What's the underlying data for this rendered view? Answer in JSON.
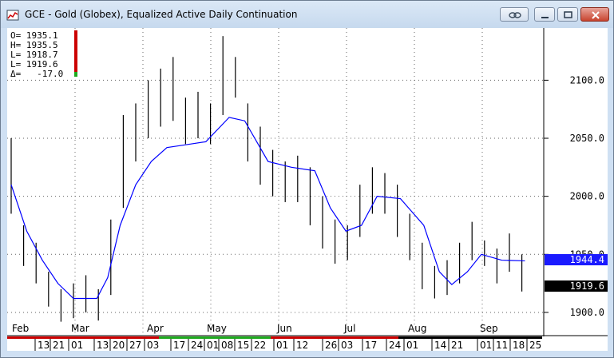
{
  "window": {
    "title": "GCE - Gold (Globex), Equalized Active Daily Continuation",
    "buttons": {
      "link": "link-icon",
      "minimize": "minimize-icon",
      "restore": "restore-icon",
      "close": "close-icon"
    }
  },
  "info": {
    "open": "O= 1935.1",
    "high": "H= 1935.5",
    "low": "L= 1918.7",
    "last": "L= 1919.6",
    "change": "Δ=   -17.0"
  },
  "price_axis": {
    "ticks": [
      "2100.0",
      "2050.0",
      "2000.0",
      "1950.0",
      "1900.0"
    ],
    "ma_label": "1944.4",
    "last_label": "1919.6"
  },
  "time_axis": {
    "months": [
      "Feb",
      "Mar",
      "Apr",
      "May",
      "Jun",
      "Jul",
      "Aug",
      "Sep"
    ],
    "days": [
      "13",
      "21",
      "01",
      "13",
      "20",
      "27",
      "03",
      "17",
      "24",
      "01",
      "08",
      "15",
      "22",
      "01",
      "12",
      "26",
      "03",
      "17",
      "24",
      "01",
      "14",
      "21",
      "01",
      "11",
      "18",
      "25"
    ]
  },
  "colors": {
    "ma_line": "#0000ff",
    "ma_label_bg": "#1a1aff",
    "last_label_bg": "#000000",
    "up_change": "#1faa1f",
    "down_change": "#cc0000"
  },
  "chart_data": {
    "type": "bar",
    "ylim": [
      1880,
      2145
    ],
    "moving_average": [
      {
        "x": 0,
        "y": 2010
      },
      {
        "x": 10,
        "y": 1970
      },
      {
        "x": 20,
        "y": 1945
      },
      {
        "x": 30,
        "y": 1925
      },
      {
        "x": 40,
        "y": 1912
      },
      {
        "x": 55,
        "y": 1912
      },
      {
        "x": 62,
        "y": 1930
      },
      {
        "x": 70,
        "y": 1975
      },
      {
        "x": 80,
        "y": 2010
      },
      {
        "x": 90,
        "y": 2030
      },
      {
        "x": 100,
        "y": 2042
      },
      {
        "x": 115,
        "y": 2045
      },
      {
        "x": 125,
        "y": 2047
      },
      {
        "x": 140,
        "y": 2068
      },
      {
        "x": 150,
        "y": 2065
      },
      {
        "x": 165,
        "y": 2030
      },
      {
        "x": 180,
        "y": 2025
      },
      {
        "x": 195,
        "y": 2022
      },
      {
        "x": 205,
        "y": 1990
      },
      {
        "x": 215,
        "y": 1970
      },
      {
        "x": 225,
        "y": 1975
      },
      {
        "x": 235,
        "y": 2000
      },
      {
        "x": 250,
        "y": 1998
      },
      {
        "x": 265,
        "y": 1975
      },
      {
        "x": 275,
        "y": 1935
      },
      {
        "x": 283,
        "y": 1924
      },
      {
        "x": 293,
        "y": 1935
      },
      {
        "x": 302,
        "y": 1950
      },
      {
        "x": 315,
        "y": 1945
      },
      {
        "x": 330,
        "y": 1944.4
      }
    ],
    "bars": [
      {
        "x": 0,
        "h": 2050,
        "l": 1985
      },
      {
        "x": 8,
        "h": 1975,
        "l": 1940
      },
      {
        "x": 16,
        "h": 1960,
        "l": 1925
      },
      {
        "x": 24,
        "h": 1935,
        "l": 1905
      },
      {
        "x": 32,
        "h": 1920,
        "l": 1892
      },
      {
        "x": 40,
        "h": 1925,
        "l": 1895
      },
      {
        "x": 48,
        "h": 1932,
        "l": 1900
      },
      {
        "x": 56,
        "h": 1920,
        "l": 1893
      },
      {
        "x": 64,
        "h": 1980,
        "l": 1915
      },
      {
        "x": 72,
        "h": 2070,
        "l": 1990
      },
      {
        "x": 80,
        "h": 2080,
        "l": 2030
      },
      {
        "x": 88,
        "h": 2100,
        "l": 2050
      },
      {
        "x": 96,
        "h": 2110,
        "l": 2060
      },
      {
        "x": 104,
        "h": 2120,
        "l": 2065
      },
      {
        "x": 112,
        "h": 2085,
        "l": 2045
      },
      {
        "x": 120,
        "h": 2090,
        "l": 2050
      },
      {
        "x": 128,
        "h": 2080,
        "l": 2045
      },
      {
        "x": 136,
        "h": 2138,
        "l": 2070
      },
      {
        "x": 144,
        "h": 2120,
        "l": 2085
      },
      {
        "x": 152,
        "h": 2080,
        "l": 2030
      },
      {
        "x": 160,
        "h": 2060,
        "l": 2010
      },
      {
        "x": 168,
        "h": 2040,
        "l": 2000
      },
      {
        "x": 176,
        "h": 2030,
        "l": 1995
      },
      {
        "x": 184,
        "h": 2035,
        "l": 1995
      },
      {
        "x": 192,
        "h": 2025,
        "l": 1975
      },
      {
        "x": 200,
        "h": 2000,
        "l": 1955
      },
      {
        "x": 208,
        "h": 1980,
        "l": 1942
      },
      {
        "x": 216,
        "h": 1975,
        "l": 1945
      },
      {
        "x": 224,
        "h": 2010,
        "l": 1965
      },
      {
        "x": 232,
        "h": 2025,
        "l": 1985
      },
      {
        "x": 240,
        "h": 2020,
        "l": 1985
      },
      {
        "x": 248,
        "h": 2010,
        "l": 1965
      },
      {
        "x": 256,
        "h": 1985,
        "l": 1945
      },
      {
        "x": 264,
        "h": 1960,
        "l": 1920
      },
      {
        "x": 272,
        "h": 1940,
        "l": 1912
      },
      {
        "x": 280,
        "h": 1945,
        "l": 1915
      },
      {
        "x": 288,
        "h": 1960,
        "l": 1925
      },
      {
        "x": 296,
        "h": 1978,
        "l": 1945
      },
      {
        "x": 304,
        "h": 1962,
        "l": 1940
      },
      {
        "x": 312,
        "h": 1955,
        "l": 1925
      },
      {
        "x": 320,
        "h": 1968,
        "l": 1935
      },
      {
        "x": 328,
        "h": 1950,
        "l": 1918
      }
    ]
  }
}
